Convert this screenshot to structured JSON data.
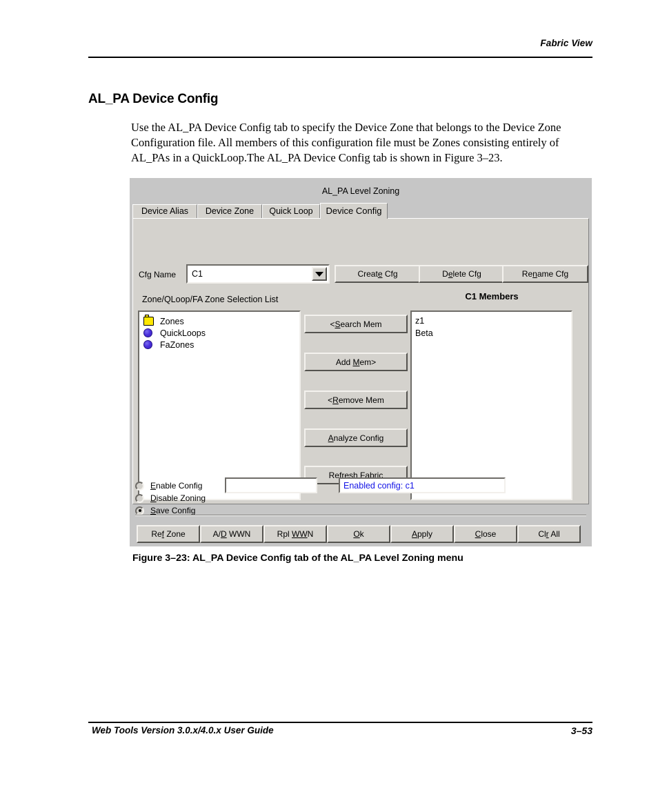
{
  "page": {
    "header_right": "Fabric View",
    "section_title": "AL_PA Device Config",
    "body_paragraph": "Use the AL_PA Device Config tab to specify the Device Zone that belongs to the Device Zone Configuration file. All members of this configuration file must be Zones consisting entirely of AL_PAs in a QuickLoop.The AL_PA Device Config tab is shown in Figure 3–23.",
    "figure_caption": "Figure 3–23:  AL_PA Device Config tab of the AL_PA Level Zoning menu",
    "footer_left": "Web Tools Version 3.0.x/4.0.x User Guide",
    "footer_right": "3–53"
  },
  "dialog": {
    "title": "AL_PA Level Zoning",
    "tabs": [
      {
        "label": "Device Alias",
        "active": false
      },
      {
        "label": "Device Zone",
        "active": false
      },
      {
        "label": "Quick Loop",
        "active": false
      },
      {
        "label": "Device Config",
        "active": true
      }
    ],
    "cfg_row": {
      "label": "Cfg Name",
      "value": "C1",
      "dropdown_icon": "chevron-down-icon",
      "buttons": [
        {
          "pre": "Creat",
          "mnemonic": "e",
          "post": " Cfg"
        },
        {
          "pre": "D",
          "mnemonic": "e",
          "post": "lete Cfg"
        },
        {
          "pre": "Re",
          "mnemonic": "n",
          "post": "ame Cfg"
        }
      ]
    },
    "selection_list": {
      "label": "Zone/QLoop/FA Zone Selection List",
      "items": [
        {
          "label": "Zones",
          "icon": "folder-icon"
        },
        {
          "label": "QuickLoops",
          "icon": "sphere-icon"
        },
        {
          "label": "FaZones",
          "icon": "sphere-icon"
        }
      ]
    },
    "members": {
      "label": "C1 Members",
      "items": [
        "z1",
        "Beta"
      ]
    },
    "transfer_buttons": [
      {
        "pre": "<",
        "mnemonic": "S",
        "post": "earch Mem"
      },
      {
        "pre": "Add ",
        "mnemonic": "M",
        "post": "em>"
      },
      {
        "pre": "<",
        "mnemonic": "R",
        "post": "emove Mem"
      },
      {
        "pre": "",
        "mnemonic": "A",
        "post": "nalyze Config"
      },
      {
        "pre": "Re",
        "mnemonic": "f",
        "post": "resh Fabric"
      }
    ],
    "options": [
      {
        "pre": "",
        "mnemonic": "E",
        "post": "nable Config",
        "selected": false
      },
      {
        "pre": "",
        "mnemonic": "D",
        "post": "isable Zoning",
        "selected": false
      },
      {
        "pre": "",
        "mnemonic": "S",
        "post": "ave Config",
        "selected": true
      }
    ],
    "edit_field_value": "",
    "status_text": "Enabled config: c1",
    "footer_buttons": [
      {
        "pre": "Re",
        "mnemonic": "f",
        "post": " Zone"
      },
      {
        "pre": "A/",
        "mnemonic": "D",
        "post": " WWN"
      },
      {
        "pre": "Rpl ",
        "mnemonic": "WW",
        "post": "N"
      },
      {
        "pre": "",
        "mnemonic": "O",
        "post": "k"
      },
      {
        "pre": "",
        "mnemonic": "A",
        "post": "pply"
      },
      {
        "pre": "",
        "mnemonic": "C",
        "post": "lose"
      },
      {
        "pre": "Cl",
        "mnemonic": "r",
        "post": " All"
      }
    ]
  },
  "colors": {
    "dialog_chrome": "#c6c6c6",
    "panel": "#d4d2cd",
    "status_text": "#1414e6",
    "folder_icon": "#ffe800",
    "sphere_icon": "#4a2fdc"
  }
}
